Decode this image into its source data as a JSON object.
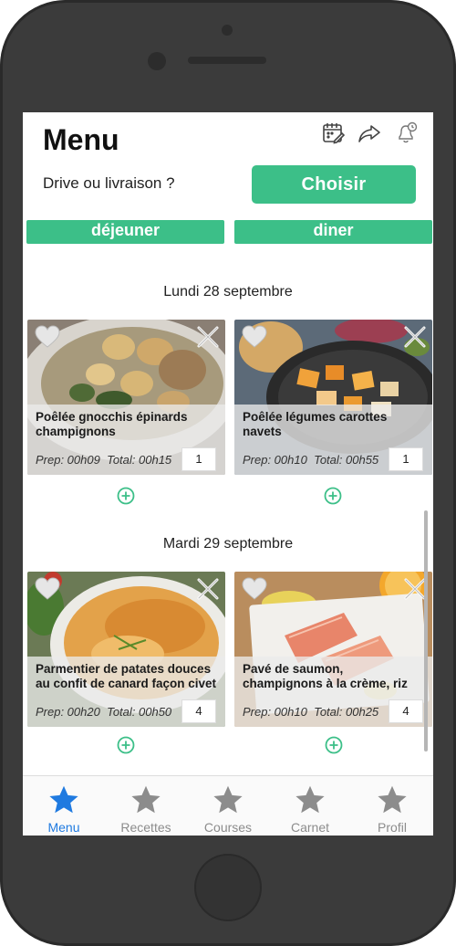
{
  "header": {
    "title": "Menu",
    "icons": [
      "calendar-edit-icon",
      "share-icon",
      "bell-clock-icon"
    ]
  },
  "delivery": {
    "question": "Drive ou livraison ?",
    "choose_label": "Choisir"
  },
  "meal_tabs": [
    "déjeuner",
    "diner"
  ],
  "days": [
    {
      "label": "Lundi 28 septembre",
      "recipes": [
        {
          "title": "Poêlée gnocchis épinards champignons",
          "prep": "Prep: 00h09",
          "total": "Total: 00h15",
          "qty": "1"
        },
        {
          "title": "Poêlée légumes carottes navets",
          "prep": "Prep: 00h10",
          "total": "Total: 00h55",
          "qty": "1"
        }
      ]
    },
    {
      "label": "Mardi 29 septembre",
      "recipes": [
        {
          "title": "Parmentier de patates douces au confit de canard façon civet",
          "prep": "Prep: 00h20",
          "total": "Total: 00h50",
          "qty": "4"
        },
        {
          "title": "Pavé de saumon, champignons à la crème, riz",
          "prep": "Prep: 00h10",
          "total": "Total: 00h25",
          "qty": "4"
        }
      ]
    }
  ],
  "tabbar": [
    {
      "label": "Menu",
      "active": true
    },
    {
      "label": "Recettes",
      "active": false
    },
    {
      "label": "Courses",
      "active": false
    },
    {
      "label": "Carnet",
      "active": false
    },
    {
      "label": "Profil",
      "active": false
    }
  ],
  "colors": {
    "accent": "#3cbf88",
    "active_tab": "#1f7ae0",
    "inactive_tab": "#8c8c8c"
  }
}
